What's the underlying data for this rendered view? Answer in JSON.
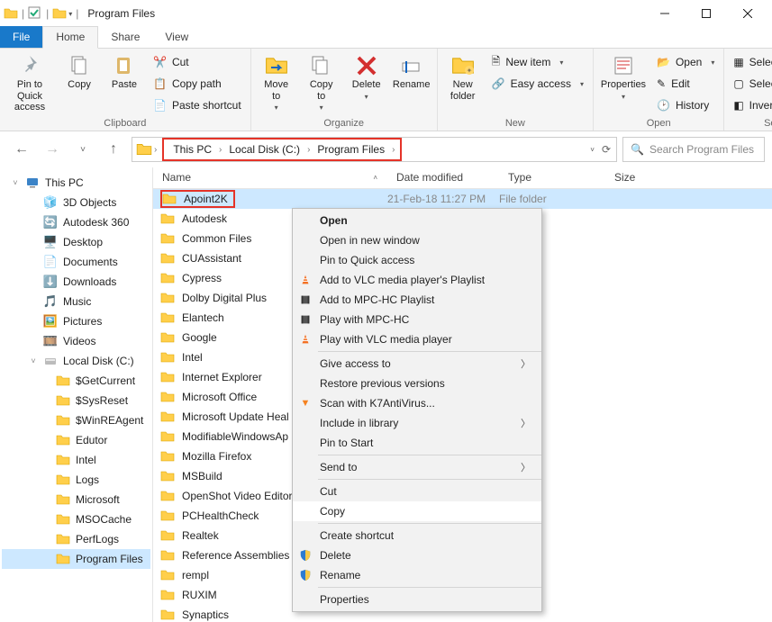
{
  "window": {
    "title": "Program Files"
  },
  "tabs": {
    "file": "File",
    "home": "Home",
    "share": "Share",
    "view": "View"
  },
  "ribbon": {
    "pin": "Pin to Quick\naccess",
    "copy": "Copy",
    "paste": "Paste",
    "cut": "Cut",
    "copypath": "Copy path",
    "pastesc": "Paste shortcut",
    "clipboard_label": "Clipboard",
    "moveto": "Move\nto",
    "copyto": "Copy\nto",
    "delete": "Delete",
    "rename": "Rename",
    "organize_label": "Organize",
    "newfolder": "New\nfolder",
    "newitem": "New item",
    "easyaccess": "Easy access",
    "new_label": "New",
    "properties": "Properties",
    "open": "Open",
    "edit": "Edit",
    "history": "History",
    "open_label": "Open",
    "selectall": "Select all",
    "selectnone": "Select none",
    "invertsel": "Invert selection",
    "select_label": "Select"
  },
  "breadcrumbs": [
    "This PC",
    "Local Disk (C:)",
    "Program Files"
  ],
  "search": {
    "placeholder": "Search Program Files"
  },
  "tree": [
    {
      "label": "This PC",
      "icon": "pc",
      "indent": 0,
      "chev": "˅"
    },
    {
      "label": "3D Objects",
      "icon": "3d",
      "indent": 1,
      "chev": ""
    },
    {
      "label": "Autodesk 360",
      "icon": "a360",
      "indent": 1,
      "chev": ""
    },
    {
      "label": "Desktop",
      "icon": "desktop",
      "indent": 1,
      "chev": ""
    },
    {
      "label": "Documents",
      "icon": "docs",
      "indent": 1,
      "chev": ""
    },
    {
      "label": "Downloads",
      "icon": "dl",
      "indent": 1,
      "chev": ""
    },
    {
      "label": "Music",
      "icon": "music",
      "indent": 1,
      "chev": ""
    },
    {
      "label": "Pictures",
      "icon": "pics",
      "indent": 1,
      "chev": ""
    },
    {
      "label": "Videos",
      "icon": "vids",
      "indent": 1,
      "chev": ""
    },
    {
      "label": "Local Disk (C:)",
      "icon": "disk",
      "indent": 1,
      "chev": "˅"
    },
    {
      "label": "$GetCurrent",
      "icon": "folder",
      "indent": 2,
      "chev": ""
    },
    {
      "label": "$SysReset",
      "icon": "folder",
      "indent": 2,
      "chev": ""
    },
    {
      "label": "$WinREAgent",
      "icon": "folder",
      "indent": 2,
      "chev": ""
    },
    {
      "label": "Edutor",
      "icon": "folder",
      "indent": 2,
      "chev": ""
    },
    {
      "label": "Intel",
      "icon": "folder",
      "indent": 2,
      "chev": ""
    },
    {
      "label": "Logs",
      "icon": "folder",
      "indent": 2,
      "chev": ""
    },
    {
      "label": "Microsoft",
      "icon": "folder",
      "indent": 2,
      "chev": ""
    },
    {
      "label": "MSOCache",
      "icon": "folder",
      "indent": 2,
      "chev": ""
    },
    {
      "label": "PerfLogs",
      "icon": "folder",
      "indent": 2,
      "chev": ""
    },
    {
      "label": "Program Files",
      "icon": "folder",
      "indent": 2,
      "chev": "",
      "sel": true
    }
  ],
  "columns": {
    "name": "Name",
    "date": "Date modified",
    "type": "Type",
    "size": "Size"
  },
  "rows": [
    {
      "name": "Apoint2K",
      "date": "21-Feb-18 11:27 PM",
      "type": "File folder",
      "sel": true,
      "boxed": true
    },
    {
      "name": "Autodesk"
    },
    {
      "name": "Common Files"
    },
    {
      "name": "CUAssistant"
    },
    {
      "name": "Cypress"
    },
    {
      "name": "Dolby Digital Plus"
    },
    {
      "name": "Elantech"
    },
    {
      "name": "Google"
    },
    {
      "name": "Intel"
    },
    {
      "name": "Internet Explorer"
    },
    {
      "name": "Microsoft Office"
    },
    {
      "name": "Microsoft Update Heal"
    },
    {
      "name": "ModifiableWindowsAp"
    },
    {
      "name": "Mozilla Firefox"
    },
    {
      "name": "MSBuild"
    },
    {
      "name": "OpenShot Video Editor"
    },
    {
      "name": "PCHealthCheck"
    },
    {
      "name": "Realtek"
    },
    {
      "name": "Reference Assemblies"
    },
    {
      "name": "rempl"
    },
    {
      "name": "RUXIM"
    },
    {
      "name": "Synaptics"
    }
  ],
  "context_menu": [
    {
      "label": "Open",
      "bold": true
    },
    {
      "label": "Open in new window"
    },
    {
      "label": "Pin to Quick access"
    },
    {
      "label": "Add to VLC media player's Playlist",
      "icon": "vlc"
    },
    {
      "label": "Add to MPC-HC Playlist",
      "icon": "mpc"
    },
    {
      "label": "Play with MPC-HC",
      "icon": "mpc"
    },
    {
      "label": "Play with VLC media player",
      "icon": "vlc"
    },
    {
      "sep": true
    },
    {
      "label": "Give access to",
      "sub": true
    },
    {
      "label": "Restore previous versions"
    },
    {
      "label": "Scan with K7AntiVirus...",
      "icon": "k7"
    },
    {
      "label": "Include in library",
      "sub": true
    },
    {
      "label": "Pin to Start"
    },
    {
      "sep": true
    },
    {
      "label": "Send to",
      "sub": true
    },
    {
      "sep": true
    },
    {
      "label": "Cut"
    },
    {
      "label": "Copy",
      "hover": true
    },
    {
      "sep": true
    },
    {
      "label": "Create shortcut"
    },
    {
      "label": "Delete",
      "icon": "shield"
    },
    {
      "label": "Rename",
      "icon": "shield"
    },
    {
      "sep": true
    },
    {
      "label": "Properties"
    }
  ]
}
